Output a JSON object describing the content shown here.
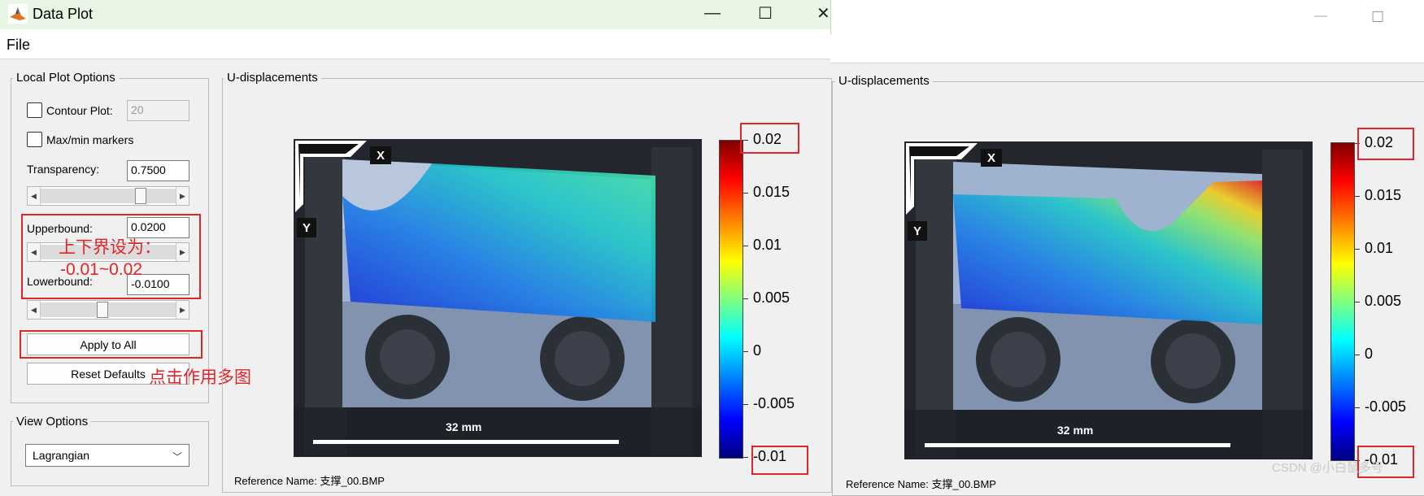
{
  "window": {
    "title": "Data Plot",
    "minimize_glyph": "—",
    "maximize_glyph": "☐",
    "close_glyph": "✕"
  },
  "menu": {
    "file": "File"
  },
  "local_plot_options": {
    "title": "Local Plot Options",
    "contour_label": "Contour Plot:",
    "contour_value": "20",
    "maxmin_label": "Max/min markers",
    "transparency_label": "Transparency:",
    "transparency_value": "0.7500",
    "transparency_slider": 0.75,
    "upperbound_label": "Upperbound:",
    "upperbound_value": "0.0200",
    "lowerbound_label": "Lowerbound:",
    "lowerbound_value": "-0.0100",
    "lowerbound_slider": 0.45,
    "apply_button": "Apply to All",
    "reset_button": "Reset Defaults"
  },
  "view_options": {
    "title": "View Options",
    "selected": "Lagrangian"
  },
  "annotations": {
    "bounds_note_line1": "上下界设为：",
    "bounds_note_line2": "-0.01~0.02",
    "apply_note": "点击作用多图"
  },
  "plot_left": {
    "title": "U-displacements",
    "x_tag": "X",
    "y_tag": "Y",
    "scale_text": "32 mm",
    "reference": "Reference Name: 支撑_00.BMP",
    "colorbar_ticks": [
      "0.02",
      "0.015",
      "0.01",
      "0.005",
      "0",
      "-0.005",
      "-0.01"
    ]
  },
  "plot_right": {
    "title": "U-displacements",
    "x_tag": "X",
    "y_tag": "Y",
    "scale_text": "32 mm",
    "reference": "Reference Name: 支撑_00.BMP",
    "colorbar_ticks": [
      "0.02",
      "0.015",
      "0.01",
      "0.005",
      "0",
      "-0.005",
      "-0.01"
    ]
  },
  "watermark": "CSDN @小白鼠多号",
  "colors": {
    "annotation_red": "#e0242b",
    "titlebar_green": "#e9f6e6",
    "matlab_icon_orange": "#e5711d"
  }
}
